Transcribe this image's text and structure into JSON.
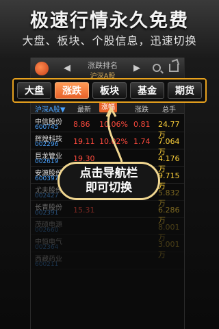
{
  "promo": {
    "headline": "极速行情永久免费",
    "subline": "大盘、板块、个股信息，迅速切换"
  },
  "topbar": {
    "title": "涨跌排名",
    "subtitle": "沪深A股"
  },
  "nav": {
    "tabs": [
      "大盘",
      "涨跌",
      "板块",
      "基金",
      "期货"
    ],
    "active_index": 1
  },
  "table": {
    "headers": [
      "沪深A股▼",
      "最新",
      "涨幅",
      "涨跌",
      "总手"
    ],
    "rows": [
      {
        "name": "中信股份",
        "code": "600745",
        "price": "8.86",
        "pct": "10.06%",
        "chg": "0.81",
        "amt": "24.77万"
      },
      {
        "name": "辉煌科技",
        "code": "002296",
        "price": "19.11",
        "pct": "10.02%",
        "chg": "1.74",
        "amt": "7.064万"
      },
      {
        "name": "巨龙管业",
        "code": "002619",
        "price": "19.30",
        "pct": "",
        "chg": "",
        "amt": "4.176万"
      },
      {
        "name": "安源股份",
        "code": "600397",
        "price": "16.14",
        "pct": "",
        "chg": "",
        "amt": "9.715万"
      },
      {
        "name": "尤夫股份",
        "code": "002427",
        "price": "6.55",
        "pct": "",
        "chg": "0.50",
        "amt": "5.832万"
      },
      {
        "name": "长青股份",
        "code": "002391",
        "price": "15.31",
        "pct": "",
        "chg": "",
        "amt": "6.286万"
      },
      {
        "name": "茂硕电源",
        "code": "002660",
        "price": "",
        "pct": "",
        "chg": "",
        "amt": "8.001万"
      },
      {
        "name": "中恒电气",
        "code": "002364",
        "price": "",
        "pct": "",
        "chg": "",
        "amt": "3.001万"
      },
      {
        "name": "西藏药业",
        "code": "600211",
        "price": "",
        "pct": "",
        "chg": "",
        "amt": ""
      }
    ]
  },
  "callout": {
    "line1": "点击导航栏",
    "line2": "即可切换"
  },
  "colors": {
    "accent": "#e8622a",
    "highlight_border": "#e8a21e",
    "up": "#ff4a3d",
    "volume": "#ffd23a",
    "code": "#4aa3ff"
  }
}
